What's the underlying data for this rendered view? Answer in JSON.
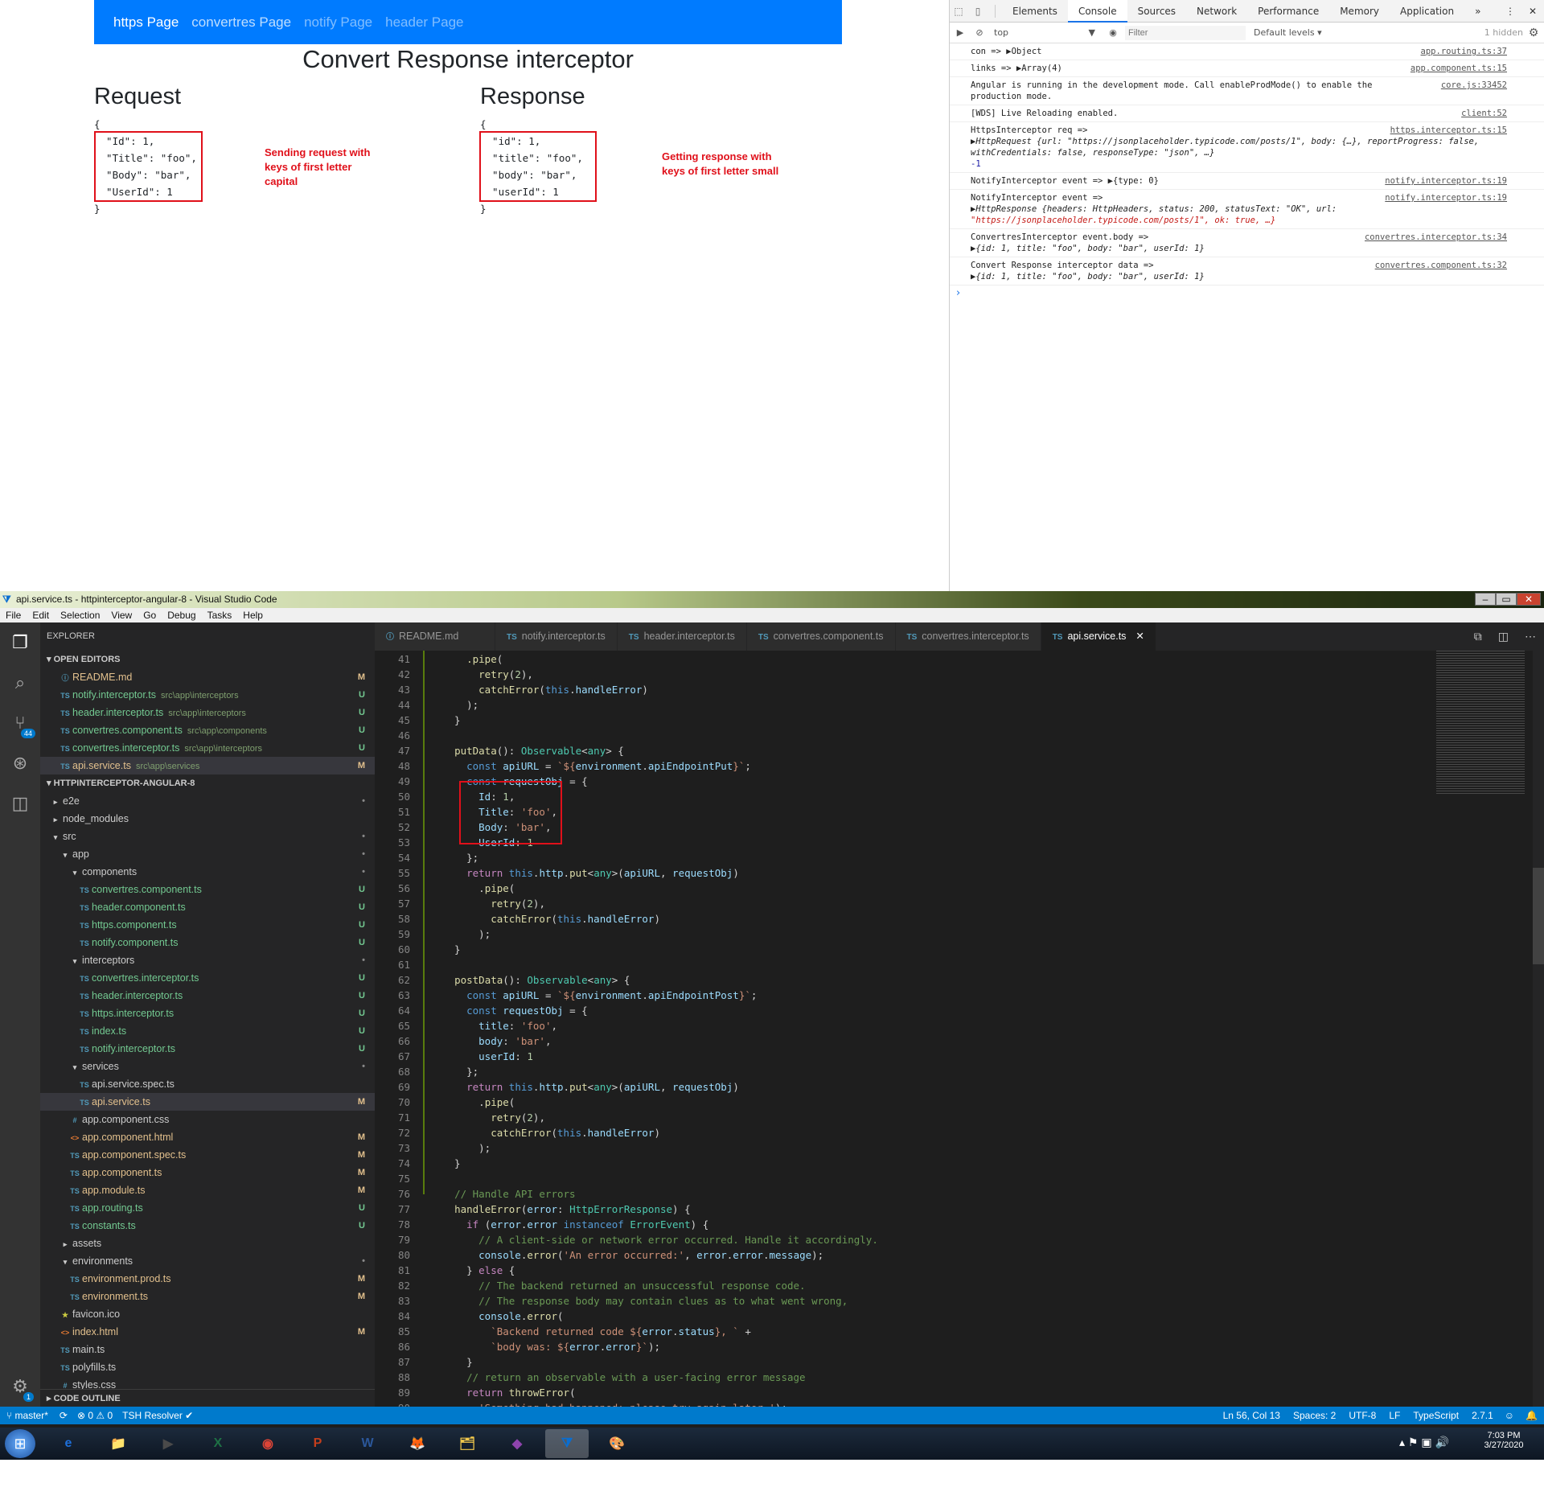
{
  "browser_page": {
    "nav": [
      "https Page",
      "convertres Page",
      "notify Page",
      "header Page"
    ],
    "active_nav": 0,
    "title": "Convert Response interceptor",
    "request": {
      "heading": "Request",
      "lines": [
        "{",
        "  \"Id\": 1,",
        "  \"Title\": \"foo\",",
        "  \"Body\": \"bar\",",
        "  \"UserId\": 1",
        "}"
      ],
      "note": "Sending request with keys of first letter capital"
    },
    "response": {
      "heading": "Response",
      "lines": [
        "{",
        "  \"id\": 1,",
        "  \"title\": \"foo\",",
        "  \"body\": \"bar\",",
        "  \"userId\": 1",
        "}"
      ],
      "note": "Getting response with keys of first letter small"
    }
  },
  "devtools": {
    "tabs": [
      "Elements",
      "Console",
      "Sources",
      "Network",
      "Performance",
      "Memory",
      "Application"
    ],
    "active_tab": "Console",
    "more_tabs": "»",
    "context": "top",
    "filter_placeholder": "Filter",
    "levels": "Default levels ▾",
    "hidden": "1 hidden",
    "logs": [
      {
        "text": "con =>  ▶Object",
        "src": "app.routing.ts:37"
      },
      {
        "text": "links =>  ▶Array(4)",
        "src": "app.component.ts:15"
      },
      {
        "text": "Angular is running in the development mode. Call enableProdMode() to enable the",
        "text2": "production mode.",
        "src": "core.js:33452"
      },
      {
        "text": "[WDS] Live Reloading enabled.",
        "src": "client:52"
      },
      {
        "text": "HttpsInterceptor req =>",
        "text2": "▶HttpRequest {url: \"https://jsonplaceholder.typicode.com/posts/1\", body: {…}, reportProgress: false,",
        "text3": "  withCredentials: false, responseType: \"json\", …}",
        "text4": "-1",
        "src": "https.interceptor.ts:15"
      },
      {
        "text": "NotifyInterceptor event =>  ▶{type: 0}",
        "src": "notify.interceptor.ts:19"
      },
      {
        "text": "NotifyInterceptor event =>",
        "text2": "▶HttpResponse {headers: HttpHeaders, status: 200, statusText: \"OK\", url:",
        "text3": "  \"https://jsonplaceholder.typicode.com/posts/1\", ok: true, …}",
        "src": "notify.interceptor.ts:19"
      },
      {
        "text": "ConvertresInterceptor event.body =>",
        "text2": "▶{id: 1, title: \"foo\", body: \"bar\", userId: 1}",
        "src": "convertres.interceptor.ts:34"
      },
      {
        "text": "Convert Response interceptor data =>",
        "text2": "▶{id: 1, title: \"foo\", body: \"bar\", userId: 1}",
        "src": "convertres.component.ts:32"
      }
    ],
    "prompt": "›"
  },
  "vscode": {
    "window_title": "api.service.ts - httpinterceptor-angular-8 - Visual Studio Code",
    "menu": [
      "File",
      "Edit",
      "Selection",
      "View",
      "Go",
      "Debug",
      "Tasks",
      "Help"
    ],
    "scm_badge": "44",
    "settings_badge": "1",
    "explorer_title": "EXPLORER",
    "open_editors_title": "OPEN EDITORS",
    "open_editors": [
      {
        "icon": "ⓘ",
        "name": "README.md",
        "path": "",
        "status": "M"
      },
      {
        "icon": "TS",
        "name": "notify.interceptor.ts",
        "path": "src\\app\\interceptors",
        "status": "U"
      },
      {
        "icon": "TS",
        "name": "header.interceptor.ts",
        "path": "src\\app\\interceptors",
        "status": "U"
      },
      {
        "icon": "TS",
        "name": "convertres.component.ts",
        "path": "src\\app\\components",
        "status": "U"
      },
      {
        "icon": "TS",
        "name": "convertres.interceptor.ts",
        "path": "src\\app\\interceptors",
        "status": "U"
      },
      {
        "icon": "TS",
        "name": "api.service.ts",
        "path": "src\\app\\services",
        "status": "M"
      }
    ],
    "project_title": "HTTPINTERCEPTOR-ANGULAR-8",
    "tree": [
      {
        "d": 0,
        "arrow": "▸",
        "name": "e2e",
        "status": "•"
      },
      {
        "d": 0,
        "arrow": "▸",
        "name": "node_modules",
        "status": ""
      },
      {
        "d": 0,
        "arrow": "▾",
        "name": "src",
        "status": "•"
      },
      {
        "d": 1,
        "arrow": "▾",
        "name": "app",
        "status": "•"
      },
      {
        "d": 2,
        "arrow": "▾",
        "name": "components",
        "status": "•"
      },
      {
        "d": 3,
        "icon": "TS",
        "name": "convertres.component.ts",
        "status": "U"
      },
      {
        "d": 3,
        "icon": "TS",
        "name": "header.component.ts",
        "status": "U"
      },
      {
        "d": 3,
        "icon": "TS",
        "name": "https.component.ts",
        "status": "U"
      },
      {
        "d": 3,
        "icon": "TS",
        "name": "notify.component.ts",
        "status": "U"
      },
      {
        "d": 2,
        "arrow": "▾",
        "name": "interceptors",
        "status": "•"
      },
      {
        "d": 3,
        "icon": "TS",
        "name": "convertres.interceptor.ts",
        "status": "U"
      },
      {
        "d": 3,
        "icon": "TS",
        "name": "header.interceptor.ts",
        "status": "U"
      },
      {
        "d": 3,
        "icon": "TS",
        "name": "https.interceptor.ts",
        "status": "U"
      },
      {
        "d": 3,
        "icon": "TS",
        "name": "index.ts",
        "status": "U"
      },
      {
        "d": 3,
        "icon": "TS",
        "name": "notify.interceptor.ts",
        "status": "U"
      },
      {
        "d": 2,
        "arrow": "▾",
        "name": "services",
        "status": "•"
      },
      {
        "d": 3,
        "icon": "TS",
        "name": "api.service.spec.ts",
        "status": ""
      },
      {
        "d": 3,
        "icon": "TS",
        "name": "api.service.ts",
        "status": "M",
        "sel": true
      },
      {
        "d": 2,
        "icon": "#",
        "name": "app.component.css",
        "status": ""
      },
      {
        "d": 2,
        "icon": "<>",
        "name": "app.component.html",
        "status": "M"
      },
      {
        "d": 2,
        "icon": "TS",
        "name": "app.component.spec.ts",
        "status": "M"
      },
      {
        "d": 2,
        "icon": "TS",
        "name": "app.component.ts",
        "status": "M"
      },
      {
        "d": 2,
        "icon": "TS",
        "name": "app.module.ts",
        "status": "M"
      },
      {
        "d": 2,
        "icon": "TS",
        "name": "app.routing.ts",
        "status": "U"
      },
      {
        "d": 2,
        "icon": "TS",
        "name": "constants.ts",
        "status": "U"
      },
      {
        "d": 1,
        "arrow": "▸",
        "name": "assets",
        "status": ""
      },
      {
        "d": 1,
        "arrow": "▾",
        "name": "environments",
        "status": "•"
      },
      {
        "d": 2,
        "icon": "TS",
        "name": "environment.prod.ts",
        "status": "M"
      },
      {
        "d": 2,
        "icon": "TS",
        "name": "environment.ts",
        "status": "M"
      },
      {
        "d": 1,
        "icon": "★",
        "name": "favicon.ico",
        "status": ""
      },
      {
        "d": 1,
        "icon": "<>",
        "name": "index.html",
        "status": "M"
      },
      {
        "d": 1,
        "icon": "TS",
        "name": "main.ts",
        "status": ""
      },
      {
        "d": 1,
        "icon": "TS",
        "name": "polyfills.ts",
        "status": ""
      },
      {
        "d": 1,
        "icon": "#",
        "name": "styles.css",
        "status": ""
      }
    ],
    "outline_title": "CODE OUTLINE",
    "tabs": [
      {
        "icon": "ⓘ",
        "name": "README.md"
      },
      {
        "icon": "TS",
        "name": "notify.interceptor.ts"
      },
      {
        "icon": "TS",
        "name": "header.interceptor.ts"
      },
      {
        "icon": "TS",
        "name": "convertres.component.ts"
      },
      {
        "icon": "TS",
        "name": "convertres.interceptor.ts"
      },
      {
        "icon": "TS",
        "name": "api.service.ts",
        "active": true
      }
    ],
    "tab_close": "✕",
    "status": {
      "branch": "master*",
      "sync": "⟳",
      "problems": "⊗ 0  ⚠ 0",
      "resolver": "TSH Resolver ✔",
      "position": "Ln 56, Col 13",
      "spaces": "Spaces: 2",
      "encoding": "UTF-8",
      "eol": "LF",
      "language": "TypeScript",
      "version": "2.7.1",
      "smile": "☺",
      "bell": "🔔"
    }
  },
  "taskbar": {
    "apps": [
      "e",
      "📁",
      "▶",
      "X",
      "◉",
      "P",
      "W",
      "🦊",
      "🗂",
      "◆",
      "⧩",
      "🎨"
    ],
    "time": "7:03 PM",
    "date": "3/27/2020"
  },
  "colors": {
    "nav": "#007bff",
    "annotation": "#e0101a",
    "status": "#007acc"
  }
}
